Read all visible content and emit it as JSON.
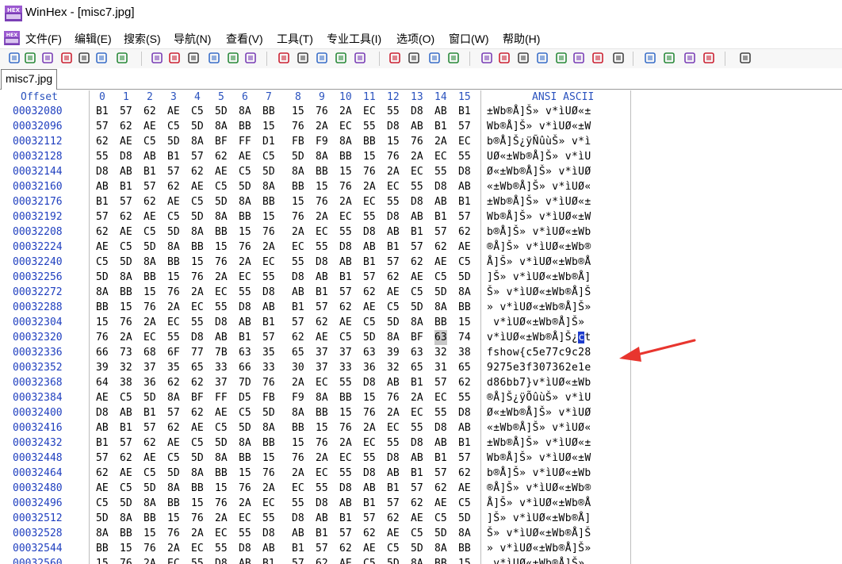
{
  "window": {
    "title": "WinHex - [misc7.jpg]",
    "app_logo": "hex-logo-icon"
  },
  "menu": [
    "文件(F)",
    "编辑(E)",
    "搜索(S)",
    "导航(N)",
    "查看(V)",
    "工具(T)",
    "专业工具(I)",
    "选项(O)",
    "窗口(W)",
    "帮助(H)"
  ],
  "toolbar_icons": [
    "new-file-icon",
    "open-file-icon",
    "save-icon",
    "print-icon",
    "properties-icon",
    "clipboard-icon",
    "export-icon",
    "undo-icon",
    "copy-icon",
    "cut-icon",
    "paste-icon",
    "paste-special-icon",
    "write-icon",
    "find-icon",
    "find-hex-icon",
    "find-text-icon",
    "replace-icon",
    "replace-hex-icon",
    "goto-icon",
    "goto-offset-icon",
    "back-icon",
    "forward-icon",
    "disk-icon",
    "open-disk-icon",
    "ram-icon",
    "calculator-icon",
    "zoom-icon",
    "hash-icon",
    "analyze-icon",
    "gear-icon",
    "grid-icon",
    "table-icon",
    "prev-icon",
    "next-icon",
    "book-icon"
  ],
  "tab": {
    "label": "misc7.jpg"
  },
  "header": {
    "offset": "Offset",
    "columns": [
      "0",
      "1",
      "2",
      "3",
      "4",
      "5",
      "6",
      "7",
      "8",
      "9",
      "10",
      "11",
      "12",
      "13",
      "14",
      "15"
    ],
    "ansi": "ANSI ASCII"
  },
  "rows": [
    {
      "offset": "00032080",
      "hex": [
        "B1",
        "57",
        "62",
        "AE",
        "C5",
        "5D",
        "8A",
        "BB",
        "15",
        "76",
        "2A",
        "EC",
        "55",
        "D8",
        "AB",
        "B1"
      ],
      "ascii": "±Wb®Å]Š» v*ìUØ«±"
    },
    {
      "offset": "00032096",
      "hex": [
        "57",
        "62",
        "AE",
        "C5",
        "5D",
        "8A",
        "BB",
        "15",
        "76",
        "2A",
        "EC",
        "55",
        "D8",
        "AB",
        "B1",
        "57"
      ],
      "ascii": "Wb®Å]Š» v*ìUØ«±W"
    },
    {
      "offset": "00032112",
      "hex": [
        "62",
        "AE",
        "C5",
        "5D",
        "8A",
        "BF",
        "FF",
        "D1",
        "FB",
        "F9",
        "8A",
        "BB",
        "15",
        "76",
        "2A",
        "EC"
      ],
      "ascii": "b®Å]Š¿ÿÑûùŠ» v*ì"
    },
    {
      "offset": "00032128",
      "hex": [
        "55",
        "D8",
        "AB",
        "B1",
        "57",
        "62",
        "AE",
        "C5",
        "5D",
        "8A",
        "BB",
        "15",
        "76",
        "2A",
        "EC",
        "55"
      ],
      "ascii": "UØ«±Wb®Å]Š» v*ìU"
    },
    {
      "offset": "00032144",
      "hex": [
        "D8",
        "AB",
        "B1",
        "57",
        "62",
        "AE",
        "C5",
        "5D",
        "8A",
        "BB",
        "15",
        "76",
        "2A",
        "EC",
        "55",
        "D8"
      ],
      "ascii": "Ø«±Wb®Å]Š» v*ìUØ"
    },
    {
      "offset": "00032160",
      "hex": [
        "AB",
        "B1",
        "57",
        "62",
        "AE",
        "C5",
        "5D",
        "8A",
        "BB",
        "15",
        "76",
        "2A",
        "EC",
        "55",
        "D8",
        "AB"
      ],
      "ascii": "«±Wb®Å]Š» v*ìUØ«"
    },
    {
      "offset": "00032176",
      "hex": [
        "B1",
        "57",
        "62",
        "AE",
        "C5",
        "5D",
        "8A",
        "BB",
        "15",
        "76",
        "2A",
        "EC",
        "55",
        "D8",
        "AB",
        "B1"
      ],
      "ascii": "±Wb®Å]Š» v*ìUØ«±"
    },
    {
      "offset": "00032192",
      "hex": [
        "57",
        "62",
        "AE",
        "C5",
        "5D",
        "8A",
        "BB",
        "15",
        "76",
        "2A",
        "EC",
        "55",
        "D8",
        "AB",
        "B1",
        "57"
      ],
      "ascii": "Wb®Å]Š» v*ìUØ«±W"
    },
    {
      "offset": "00032208",
      "hex": [
        "62",
        "AE",
        "C5",
        "5D",
        "8A",
        "BB",
        "15",
        "76",
        "2A",
        "EC",
        "55",
        "D8",
        "AB",
        "B1",
        "57",
        "62"
      ],
      "ascii": "b®Å]Š» v*ìUØ«±Wb"
    },
    {
      "offset": "00032224",
      "hex": [
        "AE",
        "C5",
        "5D",
        "8A",
        "BB",
        "15",
        "76",
        "2A",
        "EC",
        "55",
        "D8",
        "AB",
        "B1",
        "57",
        "62",
        "AE"
      ],
      "ascii": "®Å]Š» v*ìUØ«±Wb®"
    },
    {
      "offset": "00032240",
      "hex": [
        "C5",
        "5D",
        "8A",
        "BB",
        "15",
        "76",
        "2A",
        "EC",
        "55",
        "D8",
        "AB",
        "B1",
        "57",
        "62",
        "AE",
        "C5"
      ],
      "ascii": "Å]Š» v*ìUØ«±Wb®Å"
    },
    {
      "offset": "00032256",
      "hex": [
        "5D",
        "8A",
        "BB",
        "15",
        "76",
        "2A",
        "EC",
        "55",
        "D8",
        "AB",
        "B1",
        "57",
        "62",
        "AE",
        "C5",
        "5D"
      ],
      "ascii": "]Š» v*ìUØ«±Wb®Å]"
    },
    {
      "offset": "00032272",
      "hex": [
        "8A",
        "BB",
        "15",
        "76",
        "2A",
        "EC",
        "55",
        "D8",
        "AB",
        "B1",
        "57",
        "62",
        "AE",
        "C5",
        "5D",
        "8A"
      ],
      "ascii": "Š» v*ìUØ«±Wb®Å]Š"
    },
    {
      "offset": "00032288",
      "hex": [
        "BB",
        "15",
        "76",
        "2A",
        "EC",
        "55",
        "D8",
        "AB",
        "B1",
        "57",
        "62",
        "AE",
        "C5",
        "5D",
        "8A",
        "BB"
      ],
      "ascii": "» v*ìUØ«±Wb®Å]Š»"
    },
    {
      "offset": "00032304",
      "hex": [
        "15",
        "76",
        "2A",
        "EC",
        "55",
        "D8",
        "AB",
        "B1",
        "57",
        "62",
        "AE",
        "C5",
        "5D",
        "8A",
        "BB",
        "15"
      ],
      "ascii": " v*ìUØ«±Wb®Å]Š» "
    },
    {
      "offset": "00032320",
      "hex": [
        "76",
        "2A",
        "EC",
        "55",
        "D8",
        "AB",
        "B1",
        "57",
        "62",
        "AE",
        "C5",
        "5D",
        "8A",
        "BF",
        "63",
        "74"
      ],
      "ascii": "v*ìUØ«±Wb®Å]Š¿ct",
      "sel_hex": 14,
      "sel_ascii": "c"
    },
    {
      "offset": "00032336",
      "hex": [
        "66",
        "73",
        "68",
        "6F",
        "77",
        "7B",
        "63",
        "35",
        "65",
        "37",
        "37",
        "63",
        "39",
        "63",
        "32",
        "38"
      ],
      "ascii": "fshow{c5e77c9c28"
    },
    {
      "offset": "00032352",
      "hex": [
        "39",
        "32",
        "37",
        "35",
        "65",
        "33",
        "66",
        "33",
        "30",
        "37",
        "33",
        "36",
        "32",
        "65",
        "31",
        "65"
      ],
      "ascii": "9275e3f307362e1e"
    },
    {
      "offset": "00032368",
      "hex": [
        "64",
        "38",
        "36",
        "62",
        "62",
        "37",
        "7D",
        "76",
        "2A",
        "EC",
        "55",
        "D8",
        "AB",
        "B1",
        "57",
        "62"
      ],
      "ascii": "d86bb7}v*ìUØ«±Wb"
    },
    {
      "offset": "00032384",
      "hex": [
        "AE",
        "C5",
        "5D",
        "8A",
        "BF",
        "FF",
        "D5",
        "FB",
        "F9",
        "8A",
        "BB",
        "15",
        "76",
        "2A",
        "EC",
        "55"
      ],
      "ascii": "®Å]Š¿ÿÕûùŠ» v*ìU"
    },
    {
      "offset": "00032400",
      "hex": [
        "D8",
        "AB",
        "B1",
        "57",
        "62",
        "AE",
        "C5",
        "5D",
        "8A",
        "BB",
        "15",
        "76",
        "2A",
        "EC",
        "55",
        "D8"
      ],
      "ascii": "Ø«±Wb®Å]Š» v*ìUØ"
    },
    {
      "offset": "00032416",
      "hex": [
        "AB",
        "B1",
        "57",
        "62",
        "AE",
        "C5",
        "5D",
        "8A",
        "BB",
        "15",
        "76",
        "2A",
        "EC",
        "55",
        "D8",
        "AB"
      ],
      "ascii": "«±Wb®Å]Š» v*ìUØ«"
    },
    {
      "offset": "00032432",
      "hex": [
        "B1",
        "57",
        "62",
        "AE",
        "C5",
        "5D",
        "8A",
        "BB",
        "15",
        "76",
        "2A",
        "EC",
        "55",
        "D8",
        "AB",
        "B1"
      ],
      "ascii": "±Wb®Å]Š» v*ìUØ«±"
    },
    {
      "offset": "00032448",
      "hex": [
        "57",
        "62",
        "AE",
        "C5",
        "5D",
        "8A",
        "BB",
        "15",
        "76",
        "2A",
        "EC",
        "55",
        "D8",
        "AB",
        "B1",
        "57"
      ],
      "ascii": "Wb®Å]Š» v*ìUØ«±W"
    },
    {
      "offset": "00032464",
      "hex": [
        "62",
        "AE",
        "C5",
        "5D",
        "8A",
        "BB",
        "15",
        "76",
        "2A",
        "EC",
        "55",
        "D8",
        "AB",
        "B1",
        "57",
        "62"
      ],
      "ascii": "b®Å]Š» v*ìUØ«±Wb"
    },
    {
      "offset": "00032480",
      "hex": [
        "AE",
        "C5",
        "5D",
        "8A",
        "BB",
        "15",
        "76",
        "2A",
        "EC",
        "55",
        "D8",
        "AB",
        "B1",
        "57",
        "62",
        "AE"
      ],
      "ascii": "®Å]Š» v*ìUØ«±Wb®"
    },
    {
      "offset": "00032496",
      "hex": [
        "C5",
        "5D",
        "8A",
        "BB",
        "15",
        "76",
        "2A",
        "EC",
        "55",
        "D8",
        "AB",
        "B1",
        "57",
        "62",
        "AE",
        "C5"
      ],
      "ascii": "Å]Š» v*ìUØ«±Wb®Å"
    },
    {
      "offset": "00032512",
      "hex": [
        "5D",
        "8A",
        "BB",
        "15",
        "76",
        "2A",
        "EC",
        "55",
        "D8",
        "AB",
        "B1",
        "57",
        "62",
        "AE",
        "C5",
        "5D"
      ],
      "ascii": "]Š» v*ìUØ«±Wb®Å]"
    },
    {
      "offset": "00032528",
      "hex": [
        "8A",
        "BB",
        "15",
        "76",
        "2A",
        "EC",
        "55",
        "D8",
        "AB",
        "B1",
        "57",
        "62",
        "AE",
        "C5",
        "5D",
        "8A"
      ],
      "ascii": "Š» v*ìUØ«±Wb®Å]Š"
    },
    {
      "offset": "00032544",
      "hex": [
        "BB",
        "15",
        "76",
        "2A",
        "EC",
        "55",
        "D8",
        "AB",
        "B1",
        "57",
        "62",
        "AE",
        "C5",
        "5D",
        "8A",
        "BB"
      ],
      "ascii": "» v*ìUØ«±Wb®Å]Š»"
    },
    {
      "offset": "00032560",
      "hex": [
        "15",
        "76",
        "2A",
        "EC",
        "55",
        "D8",
        "AB",
        "B1",
        "57",
        "62",
        "AE",
        "C5",
        "5D",
        "8A",
        "BB",
        "15"
      ],
      "ascii": " v*ìUØ«±Wb®Å]Š» "
    }
  ],
  "colors": {
    "offset": "#1f3fbf",
    "header": "#2a52be",
    "selection": "#1e3ccc",
    "arrow": "#e8352e"
  }
}
